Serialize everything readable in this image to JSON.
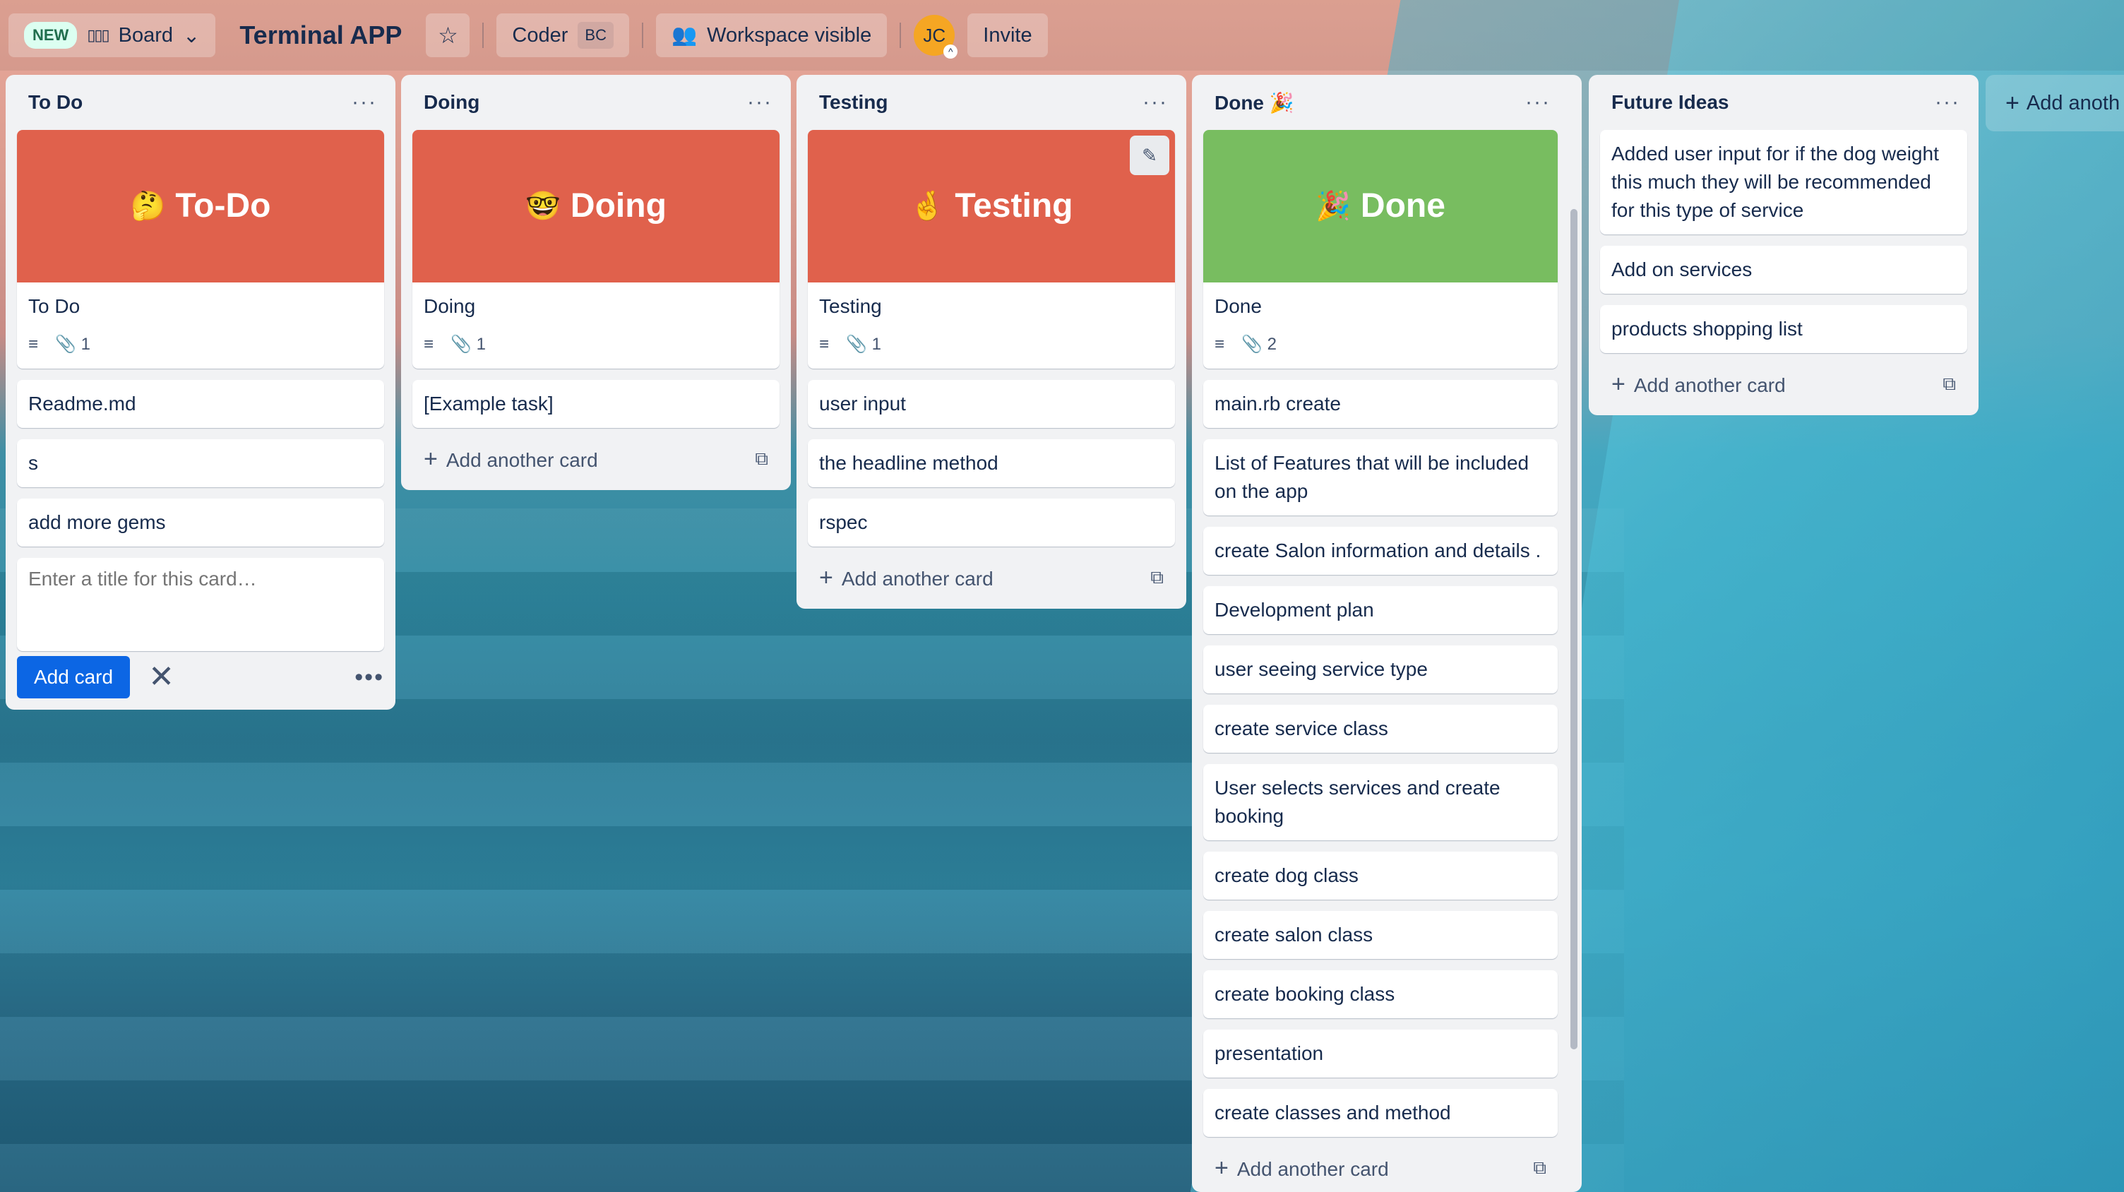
{
  "header": {
    "new_badge": "NEW",
    "view_label": "Board",
    "board_title": "Terminal APP",
    "workspace_name": "Coder",
    "workspace_badge": "BC",
    "visibility_label": "Workspace visible",
    "avatar_initials": "JC",
    "invite_label": "Invite"
  },
  "lists": [
    {
      "title": "To Do",
      "cover": {
        "emoji": "🤔",
        "text": "To-Do",
        "color": "#e0614c"
      },
      "cover_card_title": "To Do",
      "attachments": "1",
      "cards": [
        "Readme.md",
        "s",
        "add more gems"
      ],
      "composer_placeholder": "Enter a title for this card…",
      "add_card_label": "Add card"
    },
    {
      "title": "Doing",
      "cover": {
        "emoji": "🤓",
        "text": "Doing",
        "color": "#e0614c"
      },
      "cover_card_title": "Doing",
      "attachments": "1",
      "cards": [
        "[Example task]"
      ],
      "add_another_label": "Add another card"
    },
    {
      "title": "Testing",
      "cover": {
        "emoji": "🤞",
        "text": "Testing",
        "color": "#e0614c"
      },
      "cover_card_title": "Testing",
      "attachments": "1",
      "cards": [
        "user input",
        "the headline method",
        "rspec"
      ],
      "add_another_label": "Add another card"
    },
    {
      "title": "Done 🎉",
      "cover": {
        "emoji": "🎉",
        "text": "Done",
        "color": "#78bd60"
      },
      "cover_card_title": "Done",
      "attachments": "2",
      "cards": [
        "main.rb create",
        "List of Features that will be included on the app",
        "create Salon information and details .",
        "Development plan",
        "user seeing service type",
        "create service class",
        "User selects services and create booking",
        "create dog class",
        "create salon class",
        "create booking class",
        "presentation",
        "create classes and method"
      ],
      "add_another_label": "Add another card"
    },
    {
      "title": "Future Ideas",
      "cards": [
        "Added user input for if the dog weight this much they will be recommended for this type of service",
        "Add on services",
        "products shopping list"
      ],
      "add_another_label": "Add another card"
    }
  ],
  "add_list_label": "Add anoth"
}
